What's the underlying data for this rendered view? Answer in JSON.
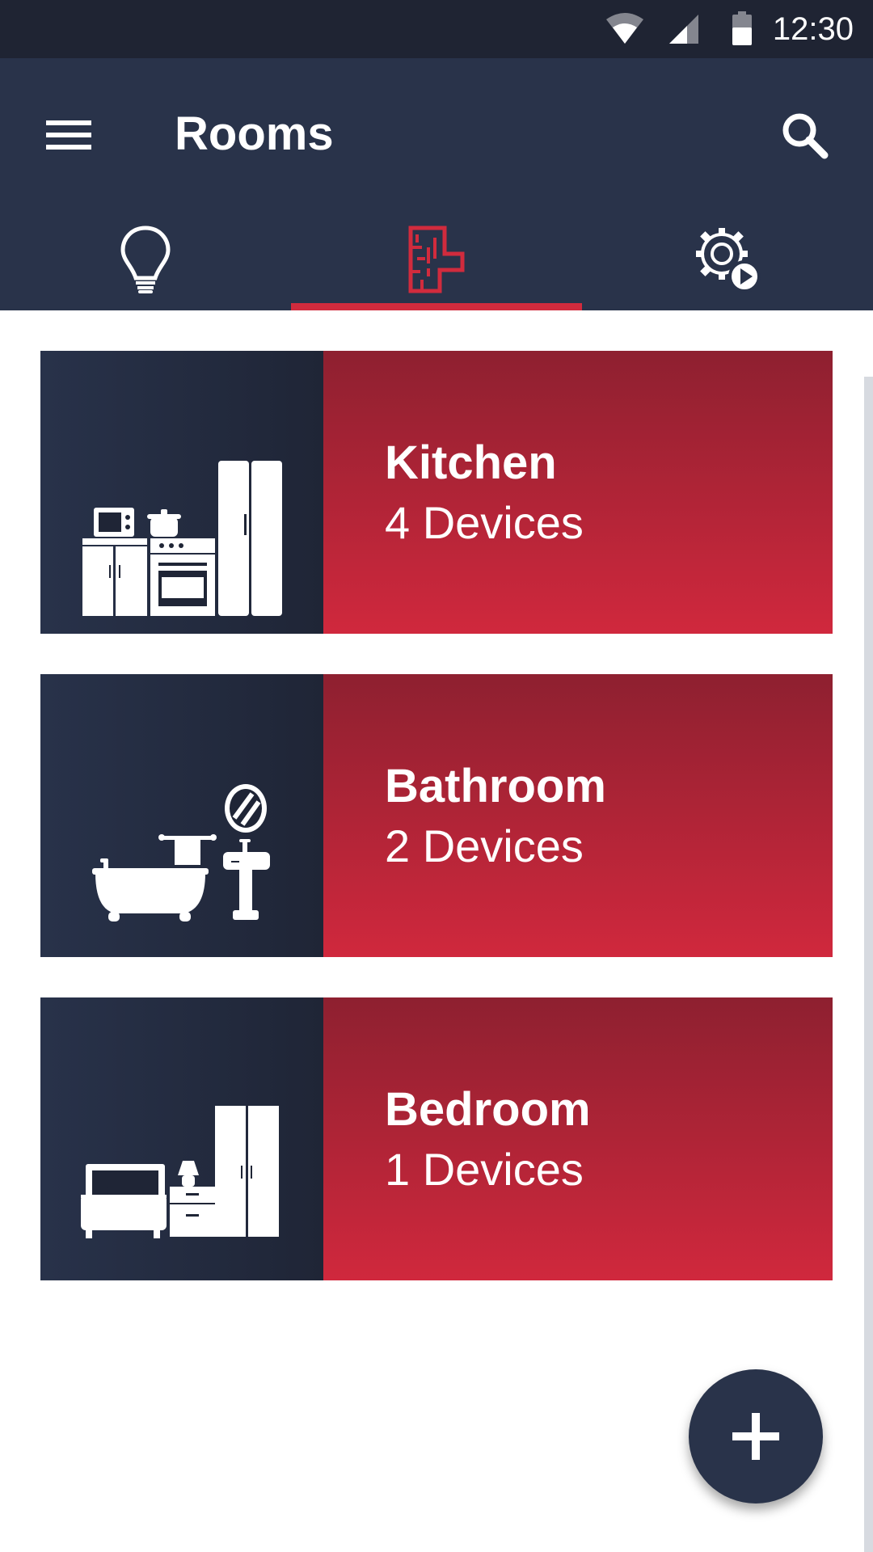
{
  "status_bar": {
    "time": "12:30",
    "icons": [
      "wifi-icon",
      "cell-signal-icon",
      "battery-icon"
    ]
  },
  "app_bar": {
    "title": "Rooms",
    "menu_icon": "menu-icon",
    "search_icon": "search-icon"
  },
  "tabs": [
    {
      "name": "lights",
      "icon": "lightbulb-icon",
      "selected": false
    },
    {
      "name": "rooms",
      "icon": "floorplan-icon",
      "selected": true
    },
    {
      "name": "scenes",
      "icon": "gear-play-icon",
      "selected": false
    }
  ],
  "colors": {
    "primary_dark": "#29334a",
    "status_bar": "#1f2433",
    "accent": "#d12b3d",
    "card_gradient_top": "#8e2030",
    "card_gradient_bottom": "#d0283d"
  },
  "rooms": [
    {
      "name": "Kitchen",
      "devices": "4 Devices",
      "icon": "kitchen-icon"
    },
    {
      "name": "Bathroom",
      "devices": "2 Devices",
      "icon": "bathroom-icon"
    },
    {
      "name": "Bedroom",
      "devices": "1 Devices",
      "icon": "bedroom-icon"
    }
  ],
  "fab": {
    "icon": "plus-icon"
  }
}
